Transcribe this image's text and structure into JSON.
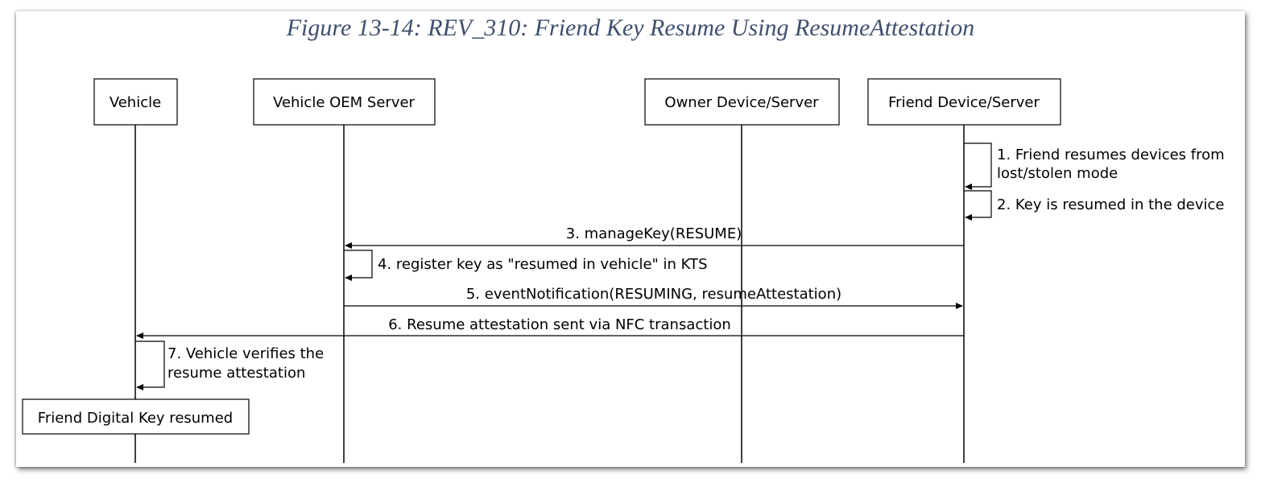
{
  "caption": "Figure 13-14: REV_310: Friend Key Resume Using ResumeAttestation",
  "participants": {
    "vehicle": "Vehicle",
    "oem_server": "Vehicle OEM Server",
    "owner_device": "Owner Device/Server",
    "friend_device": "Friend Device/Server"
  },
  "messages": {
    "m1_line1": "1. Friend resumes devices from",
    "m1_line2": "lost/stolen mode",
    "m2": "2. Key is resumed in the device",
    "m3": "3. manageKey(RESUME)",
    "m4": "4. register key as \"resumed in vehicle\" in KTS",
    "m5": "5. eventNotification(RESUMING, resumeAttestation)",
    "m6": "6. Resume attestation sent via NFC transaction",
    "m7_line1": "7. Vehicle verifies the",
    "m7_line2": "resume attestation"
  },
  "final_state": "Friend Digital Key resumed"
}
